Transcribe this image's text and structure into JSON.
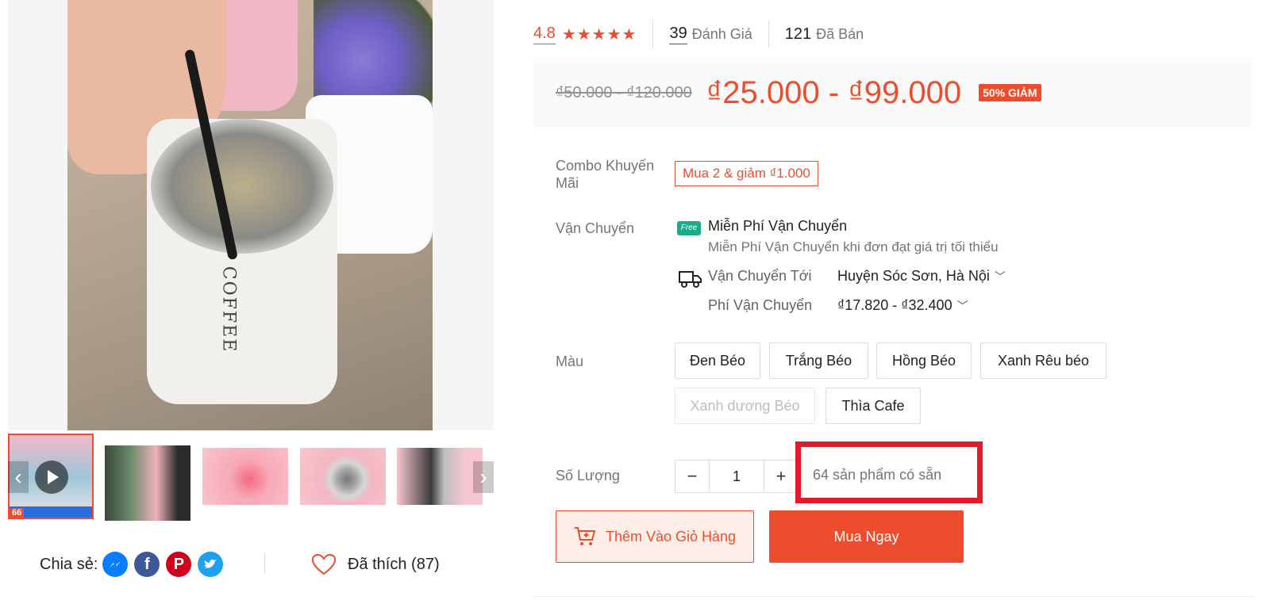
{
  "gallery": {
    "main_image_label": "COFFEE",
    "prev_arrow": "‹",
    "next_arrow": "›",
    "thumb_badge": "66"
  },
  "share": {
    "label": "Chia sẻ:",
    "networks": [
      "messenger-icon",
      "facebook-icon",
      "pinterest-icon",
      "twitter-icon"
    ]
  },
  "like": {
    "label": "Đã thích (87)"
  },
  "rating": {
    "score": "4.8",
    "stars": "★★★★★",
    "reviews_count": "39",
    "reviews_label": "Đánh Giá",
    "sold_count": "121",
    "sold_label": "Đã Bán"
  },
  "price": {
    "original_range": "₫50.000 - ₫120.000",
    "current_range": "₫25.000 - ₫99.000",
    "discount_badge": "50% GIẢM"
  },
  "combo": {
    "label": "Combo Khuyến Mãi",
    "tag": "Mua 2 & giảm ₫1.000"
  },
  "shipping": {
    "label": "Vận Chuyển",
    "free_icon_text": "Free",
    "free_title": "Miễn Phí Vận Chuyển",
    "free_subtitle": "Miễn Phí Vận Chuyển khi đơn đạt giá trị tối thiểu",
    "to_label": "Vận Chuyển Tới",
    "to_value": "Huyện Sóc Sơn, Hà Nội",
    "fee_label": "Phí Vận Chuyển",
    "fee_value": "₫17.820 - ₫32.400"
  },
  "color": {
    "label": "Màu",
    "options": [
      "Đen Béo",
      "Trắng Béo",
      "Hồng Béo",
      "Xanh Rêu béo",
      "Xanh dương Béo",
      "Thìa Cafe"
    ]
  },
  "quantity": {
    "label": "Số Lượng",
    "minus": "−",
    "value": "1",
    "plus": "+",
    "stock_text": "64 sản phẩm có sẵn"
  },
  "actions": {
    "add_to_cart": "Thêm Vào Giỏ Hàng",
    "buy_now": "Mua Ngay"
  },
  "colors": {
    "accent": "#ee4d2d",
    "highlight_box": "#e21b2c"
  }
}
